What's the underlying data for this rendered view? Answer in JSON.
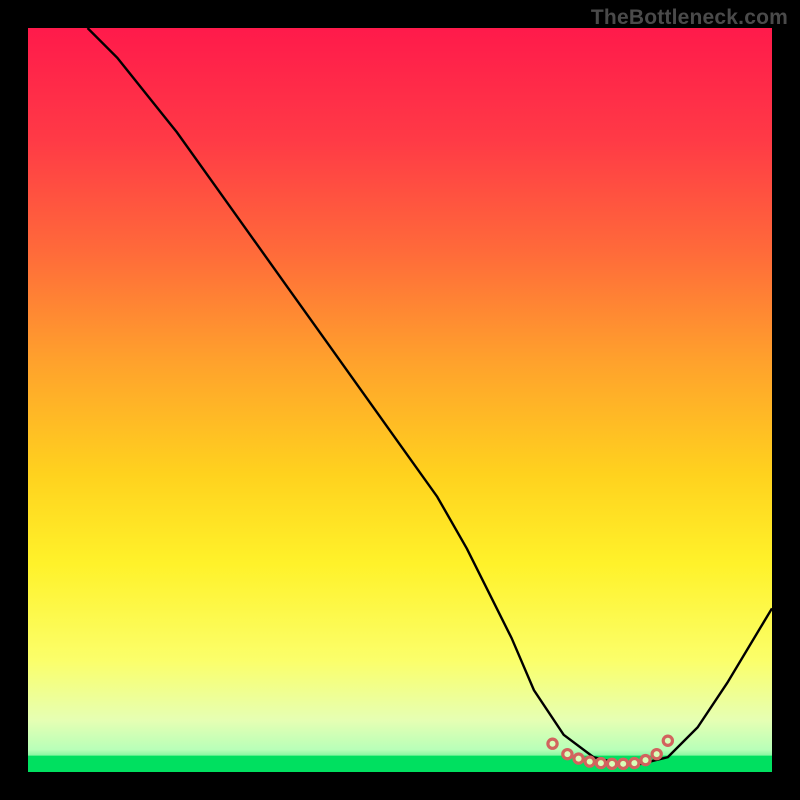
{
  "watermark": "TheBottleneck.com",
  "chart_data": {
    "type": "line",
    "title": "",
    "xlabel": "",
    "ylabel": "",
    "xlim": [
      0,
      100
    ],
    "ylim": [
      0,
      100
    ],
    "grid": false,
    "legend": false,
    "gradient_stops": [
      {
        "pos": 0.0,
        "color": "#ff1a4b"
      },
      {
        "pos": 0.15,
        "color": "#ff3a46"
      },
      {
        "pos": 0.3,
        "color": "#ff6a3a"
      },
      {
        "pos": 0.45,
        "color": "#ffa22c"
      },
      {
        "pos": 0.6,
        "color": "#ffd21e"
      },
      {
        "pos": 0.72,
        "color": "#fff22a"
      },
      {
        "pos": 0.85,
        "color": "#fbff6a"
      },
      {
        "pos": 0.93,
        "color": "#e6ffb3"
      },
      {
        "pos": 0.97,
        "color": "#b8ffb8"
      },
      {
        "pos": 1.0,
        "color": "#00e060"
      }
    ],
    "series": [
      {
        "name": "bottleneck-curve",
        "color": "#000000",
        "width": 2.4,
        "x": [
          8,
          12,
          16,
          20,
          25,
          30,
          35,
          40,
          45,
          50,
          55,
          59,
          62,
          65,
          68,
          72,
          76,
          80,
          82,
          86,
          90,
          94,
          100
        ],
        "y": [
          100,
          96,
          91,
          86,
          79,
          72,
          65,
          58,
          51,
          44,
          37,
          30,
          24,
          18,
          11,
          5,
          2,
          1,
          1,
          2,
          6,
          12,
          22
        ]
      }
    ],
    "markers": {
      "name": "optimal-range",
      "shape": "ring",
      "color_fill": "#d2635e",
      "color_stroke": "#d2635e",
      "radius_outer": 6.2,
      "radius_inner": 3.0,
      "x": [
        70.5,
        72.5,
        74.0,
        75.5,
        77.0,
        78.5,
        80.0,
        81.5,
        83.0,
        84.5,
        86.0
      ],
      "y": [
        3.8,
        2.4,
        1.8,
        1.4,
        1.2,
        1.1,
        1.1,
        1.2,
        1.6,
        2.4,
        4.2
      ]
    },
    "bottom_band": {
      "from_y": 0,
      "to_y": 2.2,
      "color": "#00e060"
    }
  }
}
